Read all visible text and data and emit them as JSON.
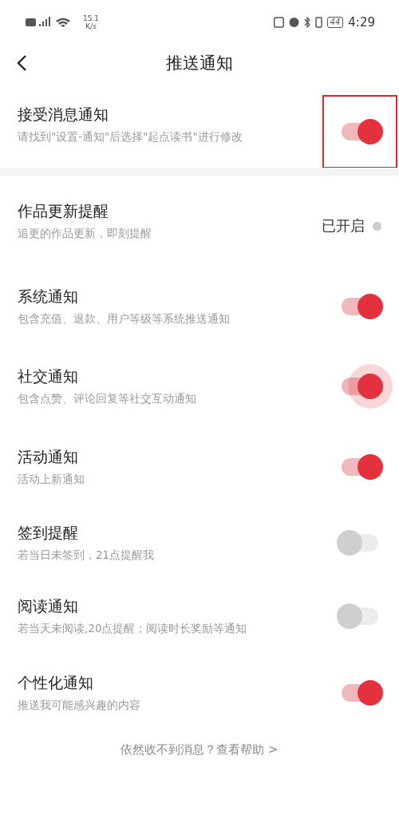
{
  "status_bar": {
    "speed_value": "15.1",
    "speed_unit": "K/s",
    "battery": "44",
    "time": "4:29"
  },
  "header": {
    "title": "推送通知"
  },
  "master": {
    "title": "接受消息通知",
    "subtitle": "请找到\"设置-通知\"后选择\"起点读书\"进行修改",
    "on": true,
    "highlighted": true
  },
  "items": [
    {
      "kind": "status",
      "title": "作品更新提醒",
      "subtitle": "追更的作品更新，即刻提醒",
      "status": "已开启"
    },
    {
      "kind": "toggle",
      "title": "系统通知",
      "subtitle": "包含充值、退款、用户等级等系统推送通知",
      "on": true,
      "pressed": false
    },
    {
      "kind": "toggle",
      "title": "社交通知",
      "subtitle": "包含点赞、评论回复等社交互动通知",
      "on": true,
      "pressed": true
    },
    {
      "kind": "toggle",
      "title": "活动通知",
      "subtitle": "活动上新通知",
      "on": true,
      "pressed": false
    },
    {
      "kind": "toggle",
      "title": "签到提醒",
      "subtitle": "若当日未签到，21点提醒我",
      "on": false,
      "pressed": false
    },
    {
      "kind": "toggle",
      "title": "阅读通知",
      "subtitle": "若当天未阅读,20点提醒；阅读时长奖励等通知",
      "on": false,
      "pressed": false
    },
    {
      "kind": "toggle",
      "title": "个性化通知",
      "subtitle": "推送我可能感兴趣的内容",
      "on": true,
      "pressed": false
    }
  ],
  "footer": {
    "link": "依然收不到消息？查看帮助 >"
  }
}
